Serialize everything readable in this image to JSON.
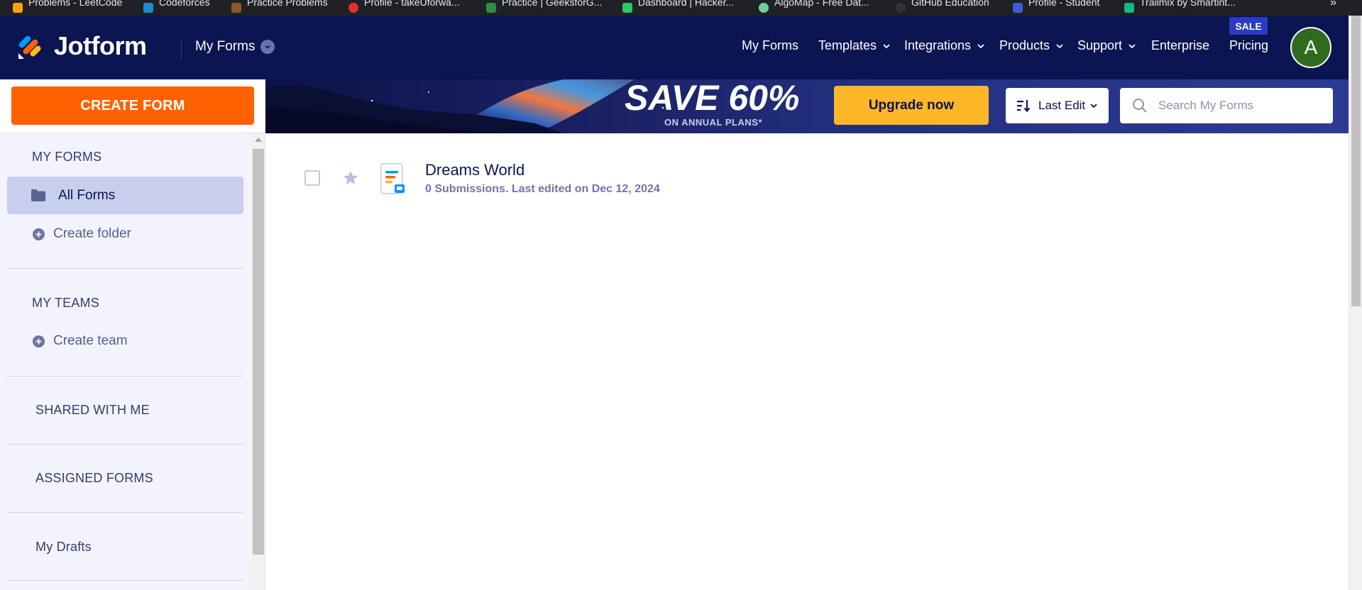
{
  "bookmarks": [
    {
      "label": "Problems - LeetCode",
      "color": "#ffa116"
    },
    {
      "label": "Codeforces",
      "color": "#1f8acb"
    },
    {
      "label": "Practice Problems",
      "color": "#8b5a2b"
    },
    {
      "label": "Profile - takeUforwa...",
      "color": "#e03131"
    },
    {
      "label": "Practice | GeeksforG...",
      "color": "#2f8d46"
    },
    {
      "label": "Dashboard | Hacker...",
      "color": "#2ec866"
    },
    {
      "label": "AlgoMap - Free Dat...",
      "color": "#6fcf97"
    },
    {
      "label": "GitHub Education",
      "color": "#333333"
    },
    {
      "label": "Profile - Student",
      "color": "#3b5bdb"
    },
    {
      "label": "Trailmix by Smartint...",
      "color": "#12b886"
    }
  ],
  "bookmarks_more_icon": "double-chevron-right-icon",
  "header": {
    "logo_text": "Jotform",
    "switcher_label": "My Forms",
    "nav": [
      {
        "label": "My Forms",
        "has_dropdown": false
      },
      {
        "label": "Templates",
        "has_dropdown": true
      },
      {
        "label": "Integrations",
        "has_dropdown": true
      },
      {
        "label": "Products",
        "has_dropdown": true
      },
      {
        "label": "Support",
        "has_dropdown": true
      },
      {
        "label": "Enterprise",
        "has_dropdown": false
      },
      {
        "label": "Pricing",
        "has_dropdown": false
      }
    ],
    "sale_badge": "SALE",
    "avatar_letter": "A"
  },
  "toolbar": {
    "create_form_label": "CREATE FORM",
    "promo_title": "SAVE 60%",
    "promo_subtitle": "ON ANNUAL PLANS*",
    "upgrade_label": "Upgrade now",
    "sort_label": "Last Edit",
    "search_placeholder": "Search My Forms"
  },
  "sidebar": {
    "my_forms_heading": "MY FORMS",
    "all_forms_label": "All Forms",
    "create_folder_label": "Create folder",
    "my_teams_heading": "MY TEAMS",
    "create_team_label": "Create team",
    "shared_heading": "SHARED WITH ME",
    "assigned_heading": "ASSIGNED FORMS",
    "drafts_label": "My Drafts"
  },
  "forms": [
    {
      "title": "Dreams World",
      "meta": "0 Submissions. Last edited on Dec 12, 2024"
    }
  ],
  "colors": {
    "header_bg": "#0a1551",
    "create_button": "#ff6100",
    "upgrade_button": "#ffb629",
    "sidebar_bg": "#f3f3fe",
    "selected_item": "#c8ceed",
    "avatar_bg": "#2f6b1f"
  }
}
